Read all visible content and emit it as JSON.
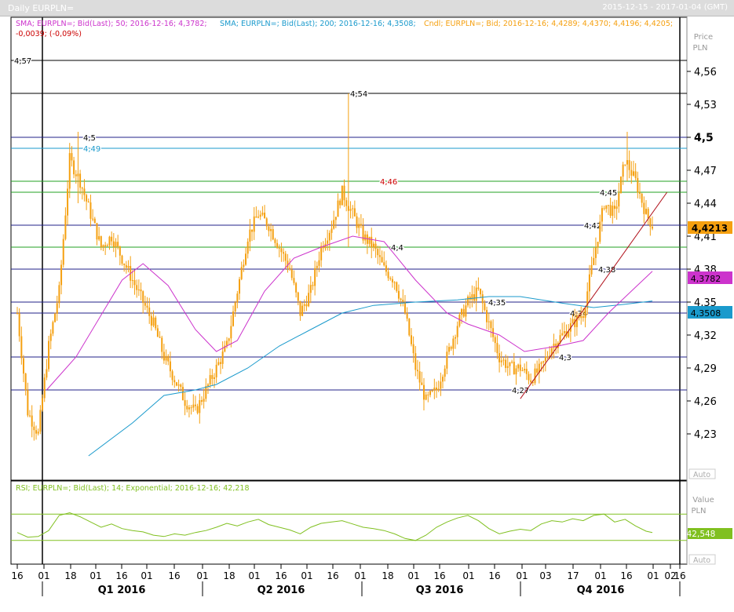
{
  "window": {
    "title": "Daily EURPLN=",
    "range": "2015-12-15 - 2017-01-04 (GMT)"
  },
  "colors": {
    "candle": "#f5a010",
    "sma50": "#cc33cc",
    "sma200": "#1a9acc",
    "rsi": "#80c020",
    "rsi_band": "#80c020",
    "trendline": "#b0101a",
    "last_bg": "#f5a010",
    "sma50_bg": "#cc33cc",
    "sma200_bg": "#1a9acc",
    "rsi_bg": "#80c020"
  },
  "legend": {
    "sma50": "SMA; EURPLN=; Bid(Last); 50; 2016-12-16; 4,3782;",
    "sma200": "SMA; EURPLN=; Bid(Last); 200; 2016-12-16; 4,3508;",
    "candles": "Cndl; EURPLN=; Bid; 2016-12-16; 4,4289; 4,4370; 4,4196; 4,4205;",
    "change": "-0,0039; (-0,09%)"
  },
  "rsi_legend": "RSI; EURPLN=; Bid(Last); 14; Exponential; 2016-12-16; 42,218",
  "price_axis": {
    "title": "Price",
    "unit": "PLN",
    "ticks": [
      "4,56",
      "4,53",
      "4,5",
      "4,47",
      "4,44",
      "4,41",
      "4,38",
      "4,35",
      "4,32",
      "4,29",
      "4,26",
      "4,23"
    ],
    "auto": "Auto"
  },
  "rsi_axis": {
    "title": "Value",
    "unit": "PLN",
    "auto": "Auto"
  },
  "tags": {
    "last": "4,4213",
    "sma50": "4,3782",
    "sma200": "4,3508",
    "rsi": "42,548"
  },
  "x_axis": {
    "days": [
      "16",
      "01",
      "18",
      "01",
      "16",
      "01",
      "16",
      "01",
      "18",
      "01",
      "16",
      "01",
      "16",
      "01",
      "18",
      "01",
      "16",
      "01",
      "16",
      "01",
      "03",
      "17",
      "01",
      "16",
      "01",
      "16",
      "02"
    ],
    "quarters": [
      "Q1 2016",
      "Q2 2016",
      "Q3 2016",
      "Q4 2016"
    ]
  },
  "chart_data": [
    {
      "type": "candlestick",
      "title": "Daily EURPLN=",
      "period": "2015-12-15 - 2017-01-04",
      "ylabel": "Price PLN",
      "ylim": [
        4.21,
        4.58
      ],
      "horizontal_levels": [
        {
          "label": "4,57",
          "value": 4.57,
          "color": "#000000"
        },
        {
          "label": "4,54",
          "value": 4.54,
          "color": "#000000"
        },
        {
          "label": "4,5",
          "value": 4.5,
          "color": "#20208a"
        },
        {
          "label": "4,49",
          "value": 4.49,
          "color": "#1a9acc"
        },
        {
          "label": "4,46",
          "value": 4.46,
          "color": "#20a020"
        },
        {
          "label": "4,45",
          "value": 4.45,
          "color": "#20a020"
        },
        {
          "label": "4,42",
          "value": 4.42,
          "color": "#20208a"
        },
        {
          "label": "4,4",
          "value": 4.4,
          "color": "#20a020"
        },
        {
          "label": "4,38",
          "value": 4.38,
          "color": "#20208a"
        },
        {
          "label": "4,35",
          "value": 4.35,
          "color": "#20208a"
        },
        {
          "label": "4,34",
          "value": 4.34,
          "color": "#20208a"
        },
        {
          "label": "4,3",
          "value": 4.3,
          "color": "#20208a"
        },
        {
          "label": "4,27",
          "value": 4.27,
          "color": "#20208a"
        }
      ],
      "close_series": [
        [
          0,
          4.34
        ],
        [
          5,
          4.25
        ],
        [
          10,
          4.23
        ],
        [
          15,
          4.31
        ],
        [
          20,
          4.36
        ],
        [
          25,
          4.48
        ],
        [
          30,
          4.46
        ],
        [
          35,
          4.43
        ],
        [
          40,
          4.4
        ],
        [
          45,
          4.41
        ],
        [
          50,
          4.39
        ],
        [
          55,
          4.37
        ],
        [
          60,
          4.35
        ],
        [
          65,
          4.33
        ],
        [
          70,
          4.3
        ],
        [
          75,
          4.28
        ],
        [
          80,
          4.26
        ],
        [
          85,
          4.25
        ],
        [
          90,
          4.27
        ],
        [
          95,
          4.29
        ],
        [
          100,
          4.31
        ],
        [
          105,
          4.36
        ],
        [
          110,
          4.41
        ],
        [
          115,
          4.43
        ],
        [
          120,
          4.42
        ],
        [
          125,
          4.4
        ],
        [
          130,
          4.38
        ],
        [
          135,
          4.34
        ],
        [
          140,
          4.36
        ],
        [
          145,
          4.4
        ],
        [
          150,
          4.42
        ],
        [
          155,
          4.45
        ],
        [
          160,
          4.43
        ],
        [
          165,
          4.41
        ],
        [
          170,
          4.4
        ],
        [
          175,
          4.38
        ],
        [
          180,
          4.37
        ],
        [
          185,
          4.34
        ],
        [
          190,
          4.29
        ],
        [
          195,
          4.26
        ],
        [
          200,
          4.27
        ],
        [
          205,
          4.3
        ],
        [
          210,
          4.33
        ],
        [
          215,
          4.35
        ],
        [
          220,
          4.36
        ],
        [
          225,
          4.33
        ],
        [
          230,
          4.3
        ],
        [
          235,
          4.29
        ],
        [
          240,
          4.29
        ],
        [
          245,
          4.28
        ],
        [
          250,
          4.29
        ],
        [
          255,
          4.31
        ],
        [
          260,
          4.32
        ],
        [
          265,
          4.33
        ],
        [
          270,
          4.34
        ],
        [
          275,
          4.39
        ],
        [
          280,
          4.44
        ],
        [
          285,
          4.43
        ],
        [
          290,
          4.48
        ],
        [
          295,
          4.46
        ],
        [
          300,
          4.43
        ],
        [
          303,
          4.42
        ]
      ],
      "sma50": [
        [
          14,
          4.27
        ],
        [
          28,
          4.3
        ],
        [
          50,
          4.37
        ],
        [
          60,
          4.385
        ],
        [
          72,
          4.365
        ],
        [
          85,
          4.325
        ],
        [
          95,
          4.305
        ],
        [
          105,
          4.315
        ],
        [
          118,
          4.36
        ],
        [
          132,
          4.39
        ],
        [
          145,
          4.4
        ],
        [
          160,
          4.41
        ],
        [
          175,
          4.405
        ],
        [
          190,
          4.37
        ],
        [
          205,
          4.34
        ],
        [
          215,
          4.33
        ],
        [
          230,
          4.32
        ],
        [
          242,
          4.305
        ],
        [
          258,
          4.31
        ],
        [
          270,
          4.315
        ],
        [
          282,
          4.34
        ],
        [
          293,
          4.36
        ],
        [
          303,
          4.378
        ]
      ],
      "sma200": [
        [
          34,
          4.21
        ],
        [
          55,
          4.24
        ],
        [
          70,
          4.265
        ],
        [
          85,
          4.27
        ],
        [
          95,
          4.275
        ],
        [
          110,
          4.29
        ],
        [
          125,
          4.31
        ],
        [
          140,
          4.325
        ],
        [
          155,
          4.34
        ],
        [
          170,
          4.347
        ],
        [
          190,
          4.35
        ],
        [
          210,
          4.352
        ],
        [
          225,
          4.355
        ],
        [
          240,
          4.355
        ],
        [
          260,
          4.349
        ],
        [
          275,
          4.345
        ],
        [
          290,
          4.348
        ],
        [
          303,
          4.351
        ]
      ],
      "trendline": [
        [
          240,
          4.262
        ],
        [
          310,
          4.45
        ]
      ]
    },
    {
      "type": "line",
      "title": "RSI",
      "ylabel": "Value PLN",
      "ylim": [
        0,
        100
      ],
      "bands": [
        30,
        70
      ],
      "series": [
        {
          "name": "RSI; EURPLN=; Bid(Last); 14; Exponential",
          "points": [
            [
              0,
              42
            ],
            [
              5,
              35
            ],
            [
              10,
              36
            ],
            [
              15,
              45
            ],
            [
              20,
              68
            ],
            [
              25,
              72
            ],
            [
              30,
              66
            ],
            [
              35,
              58
            ],
            [
              40,
              50
            ],
            [
              45,
              55
            ],
            [
              50,
              48
            ],
            [
              55,
              45
            ],
            [
              60,
              43
            ],
            [
              65,
              38
            ],
            [
              70,
              36
            ],
            [
              75,
              40
            ],
            [
              80,
              38
            ],
            [
              85,
              42
            ],
            [
              90,
              45
            ],
            [
              95,
              50
            ],
            [
              100,
              56
            ],
            [
              105,
              52
            ],
            [
              110,
              58
            ],
            [
              115,
              62
            ],
            [
              120,
              54
            ],
            [
              125,
              50
            ],
            [
              130,
              46
            ],
            [
              135,
              40
            ],
            [
              140,
              50
            ],
            [
              145,
              56
            ],
            [
              150,
              58
            ],
            [
              155,
              60
            ],
            [
              160,
              55
            ],
            [
              165,
              50
            ],
            [
              170,
              48
            ],
            [
              175,
              45
            ],
            [
              180,
              40
            ],
            [
              185,
              33
            ],
            [
              190,
              30
            ],
            [
              195,
              38
            ],
            [
              200,
              50
            ],
            [
              205,
              58
            ],
            [
              210,
              64
            ],
            [
              215,
              68
            ],
            [
              220,
              60
            ],
            [
              225,
              48
            ],
            [
              230,
              40
            ],
            [
              235,
              44
            ],
            [
              240,
              47
            ],
            [
              245,
              45
            ],
            [
              250,
              55
            ],
            [
              255,
              60
            ],
            [
              260,
              58
            ],
            [
              265,
              63
            ],
            [
              270,
              60
            ],
            [
              275,
              68
            ],
            [
              280,
              70
            ],
            [
              285,
              58
            ],
            [
              290,
              62
            ],
            [
              295,
              52
            ],
            [
              300,
              44
            ],
            [
              303,
              42
            ]
          ]
        }
      ]
    }
  ]
}
